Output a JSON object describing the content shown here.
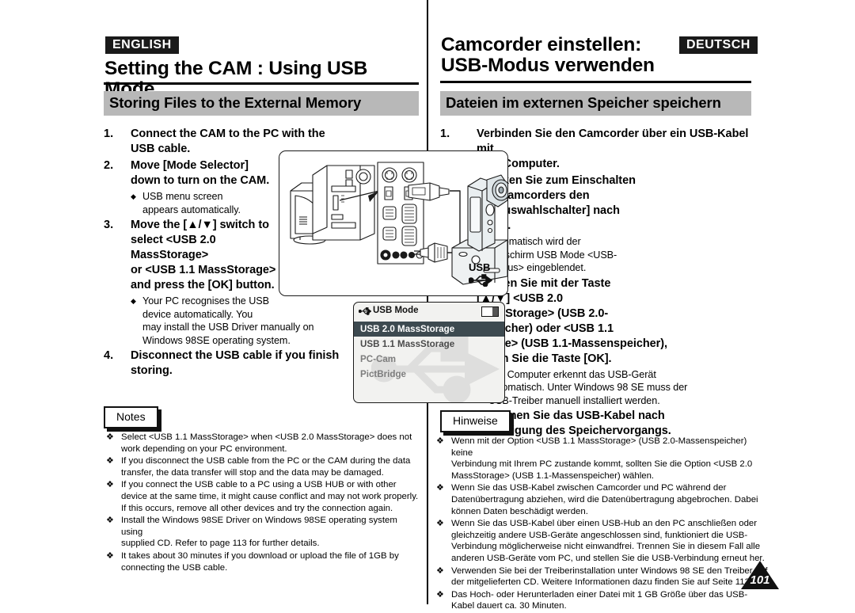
{
  "english": {
    "lang_badge": "ENGLISH",
    "chapter_title": "Setting the CAM : Using USB Mode",
    "section_title": "Storing Files to the External Memory",
    "steps": [
      {
        "num": "1.",
        "lines": [
          "Connect the CAM to the PC with the USB cable."
        ],
        "subs": []
      },
      {
        "num": "2.",
        "lines": [
          "Move [Mode Selector]",
          "down to turn on the CAM."
        ],
        "subs": [
          [
            "USB menu screen",
            "appears automatically."
          ]
        ]
      },
      {
        "num": "3.",
        "lines": [
          "Move the [▲/▼] switch to",
          "select <USB 2.0",
          "MassStorage>",
          "or  <USB 1.1 MassStorage>",
          "and press the [OK] button."
        ],
        "subs": [
          [
            "Your PC recognises the USB",
            "device automatically. You",
            "may install the USB Driver manually on",
            "Windows 98SE operating system."
          ]
        ]
      },
      {
        "num": "4.",
        "lines": [
          "Disconnect the USB cable if you finish",
          "storing."
        ],
        "subs": []
      }
    ],
    "notes_label": "Notes",
    "notes": [
      [
        "Select <USB 1.1 MassStorage> when <USB 2.0 MassStorage> does not",
        "work depending on your PC environment."
      ],
      [
        "If you disconnect the USB cable from the PC or the CAM during the data",
        "transfer, the data transfer will stop and the data may be damaged."
      ],
      [
        "If you connect the USB cable to a PC using a USB HUB or with other",
        "device at the same time, it might cause conflict and may not work properly.",
        "If this occurs, remove all other devices and try the connection again."
      ],
      [
        "Install the Windows 98SE Driver on Windows 98SE operating system using",
        "supplied CD. Refer to page 113 for further details."
      ],
      [
        "It takes about 30 minutes if you download or upload the file of 1GB by",
        "connecting the USB cable."
      ]
    ]
  },
  "german": {
    "lang_badge": "DEUTSCH",
    "chapter_title_line1": "Camcorder einstellen:",
    "chapter_title_line2": "USB-Modus verwenden",
    "section_title": "Dateien im externen Speicher speichern",
    "steps": [
      {
        "num": "1.",
        "lines": [
          "Verbinden Sie den Camcorder über ein USB-Kabel mit",
          "dem Computer."
        ],
        "subs": []
      },
      {
        "num": "2.",
        "lines": [
          "Drücken Sie zum Einschalten",
          "des Camcorders den",
          "[Moduswahlschalter] nach",
          "unten."
        ],
        "subs": [
          [
            "Automatisch wird der",
            "Bildschirm USB Mode <USB-",
            "Modus> eingeblendet."
          ]
        ]
      },
      {
        "num": "3.",
        "lines": [
          "Wählen Sie mit der Taste",
          "[▲/▼] <USB 2.0",
          "MassStorage> (USB 2.0-"
        ],
        "wide_lines": [
          "Massenspeicher) oder  <USB 1.1",
          "MassStorage> (USB 1.1-Massenspeicher),",
          "und drücken Sie die Taste [OK]."
        ],
        "subs": [
          [
            "Der Computer erkennt das USB-Gerät",
            "automatisch. Unter Windows 98 SE muss der",
            "USB-Treiber manuell installiert werden."
          ]
        ]
      },
      {
        "num": "4.",
        "lines": [
          "Entfernen Sie das USB-Kabel nach",
          "Beendigung des Speichervorgangs."
        ],
        "subs": []
      }
    ],
    "notes_label": "Hinweise",
    "notes": [
      [
        "Wenn mit der Option <USB 1.1 MassStorage> (USB 2.0-Massenspeicher) keine",
        "Verbindung mit Ihrem PC zustande kommt, sollten Sie die Option <USB 2.0",
        "MassStorage> (USB 1.1-Massenspeicher) wählen."
      ],
      [
        "Wenn Sie das USB-Kabel zwischen Camcorder und PC während der",
        "Datenübertragung abziehen, wird die Datenübertragung abgebrochen. Dabei",
        "können Daten beschädigt werden."
      ],
      [
        "Wenn Sie das USB-Kabel über einen USB-Hub an den PC anschließen oder",
        "gleichzeitig andere USB-Geräte angeschlossen sind, funktioniert die USB-",
        "Verbindung möglicherweise nicht einwandfrei. Trennen Sie in diesem Fall alle",
        "anderen USB-Geräte vom PC, und stellen Sie die USB-Verbindung erneut her."
      ],
      [
        "Verwenden Sie bei der Treiberinstallation unter Windows 98 SE den Treiber auf",
        "der mitgelieferten CD. Weitere Informationen dazu finden Sie auf Seite 113."
      ],
      [
        "Das Hoch- oder Herunterladen einer Datei mit 1 GB Größe über das USB-",
        "Kabel dauert ca. 30 Minuten."
      ]
    ]
  },
  "illustration": {
    "usb_label": "USB",
    "description": "PC tower with monitor and rear I/O port panel connected by a USB cable to a camcorder seated in its cradle"
  },
  "lcd_screen": {
    "title": "USB Mode",
    "usb_icon": "usb-icon",
    "battery_icon": "battery-icon",
    "items": [
      {
        "label": "USB 2.0 MassStorage",
        "state": "selected"
      },
      {
        "label": "USB 1.1 MassStorage",
        "state": "normal"
      },
      {
        "label": "PC-Cam",
        "state": "dim"
      },
      {
        "label": "PictBridge",
        "state": "dim"
      }
    ]
  },
  "page_number": "101",
  "colors": {
    "section_band": "#b8b8b8",
    "badge_bg": "#1a1a1a",
    "lcd_selected": "#3d4a50",
    "lcd_bg": "#f2f2f0"
  }
}
